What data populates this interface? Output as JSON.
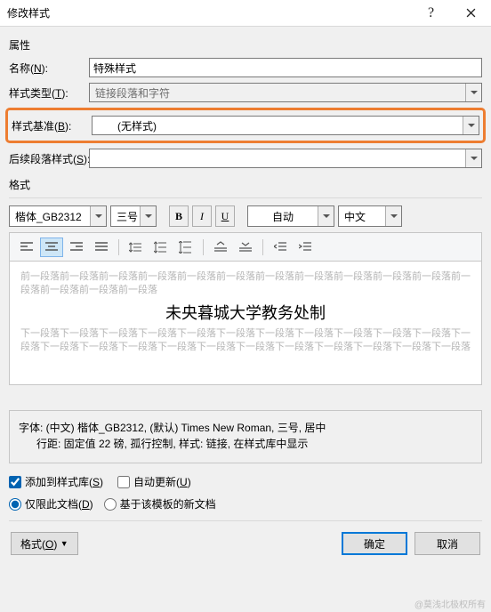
{
  "window": {
    "title": "修改样式"
  },
  "section": {
    "props": "属性",
    "fmt": "格式"
  },
  "form": {
    "name_label": "名称(N):",
    "name_value": "特殊样式",
    "type_label": "样式类型(T):",
    "type_value": "链接段落和字符",
    "base_label": "样式基准(B):",
    "base_value": "(无样式)",
    "next_label": "后续段落样式(S):",
    "next_value": ""
  },
  "toolbar1": {
    "font": "楷体_GB2312",
    "size": "三号",
    "color": "自动",
    "lang": "中文"
  },
  "preview": {
    "before": "前一段落前一段落前一段落前一段落前一段落前一段落前一段落前一段落前一段落前一段落前一段落前一段落前一段落前一段落前一段落",
    "main": "未央暮城大学教务处制",
    "after": "下一段落下一段落下一段落下一段落下一段落下一段落下一段落下一段落下一段落下一段落下一段落下一段落下一段落下一段落下一段落下一段落下一段落下一段落下一段落下一段落下一段落下一段落下一段落"
  },
  "desc": {
    "line1": "字体: (中文) 楷体_GB2312, (默认) Times New Roman, 三号, 居中",
    "line2": "行距: 固定值 22 磅, 孤行控制, 样式: 链接, 在样式库中显示"
  },
  "checks": {
    "add_lib": "添加到样式库(S)",
    "auto_update": "自动更新(U)",
    "only_doc": "仅限此文档(D)",
    "based_tpl": "基于该模板的新文档"
  },
  "footer": {
    "format_btn": "格式(O)",
    "ok": "确定",
    "cancel": "取消"
  },
  "watermark": "@莫浅北极权所有"
}
